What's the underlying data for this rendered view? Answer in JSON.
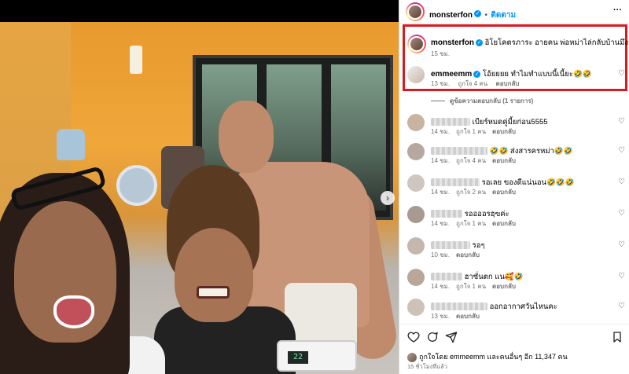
{
  "post": {
    "header": {
      "username": "monsterfon",
      "dot": "•",
      "follow_label": "ติดตาม",
      "more": "···"
    },
    "device_display": "22",
    "caption": {
      "username": "monsterfon",
      "text": "อิโยโคตรภาระ อายคน พ่อหม่าไล่กลับบ้านมึงว่าไง",
      "time": "15 ชม."
    },
    "highlight_color": "#d71920",
    "comments": [
      {
        "username": "emmeemm",
        "text": "โอ้ยยยย ทำไมทำแบบนี้เนี้ยะ🤣🤣",
        "time": "13 ชม.",
        "likes": "ถูกใจ 4 คน",
        "reply": "ตอบกลับ"
      },
      {
        "text": "เบียร์หมดคู่มี้ยก่อน5555",
        "time": "14 ชม.",
        "likes": "ถูกใจ 1 คน",
        "reply": "ตอบกลับ"
      },
      {
        "text": "🤣🤣 ส่งสารครหม่า🤣🤣",
        "time": "14 ชม.",
        "likes": "ถูกใจ 4 คน",
        "reply": "ตอบกลับ"
      },
      {
        "text": "รอเลย ของดีแน่นอน🤣🤣🤣",
        "time": "14 ชม.",
        "likes": "ถูกใจ 2 คน",
        "reply": "ตอบกลับ"
      },
      {
        "text": "รออออรฮฺฃค่ะ",
        "time": "14 ชม.",
        "likes": "ถูกใจ 1 คน",
        "reply": "ตอบกลับ"
      },
      {
        "text": "รอๆ",
        "time": "10 ชม.",
        "likes": "",
        "reply": "ตอบกลับ"
      },
      {
        "text": "ฮาซั่นตก แน🥰🤣",
        "time": "14 ชม.",
        "likes": "ถูกใจ 1 คน",
        "reply": "ตอบกลับ"
      },
      {
        "text": "ออกอากาศวันไหนคะ",
        "time": "13 ชม.",
        "likes": "",
        "reply": "ตอบกลับ"
      }
    ],
    "view_replies": "ดูข้อความตอบกลับ (1 รายการ)",
    "footer": {
      "likes_text": "ถูกใจโดย emmeemm และคนอื่นๆ อีก 11,347 คน",
      "time": "15 ชั่วโมงที่แล้ว"
    }
  },
  "icons": {
    "heart": "♡",
    "comment": "comment-icon",
    "share": "share-icon",
    "save": "bookmark-icon",
    "next": "›"
  }
}
